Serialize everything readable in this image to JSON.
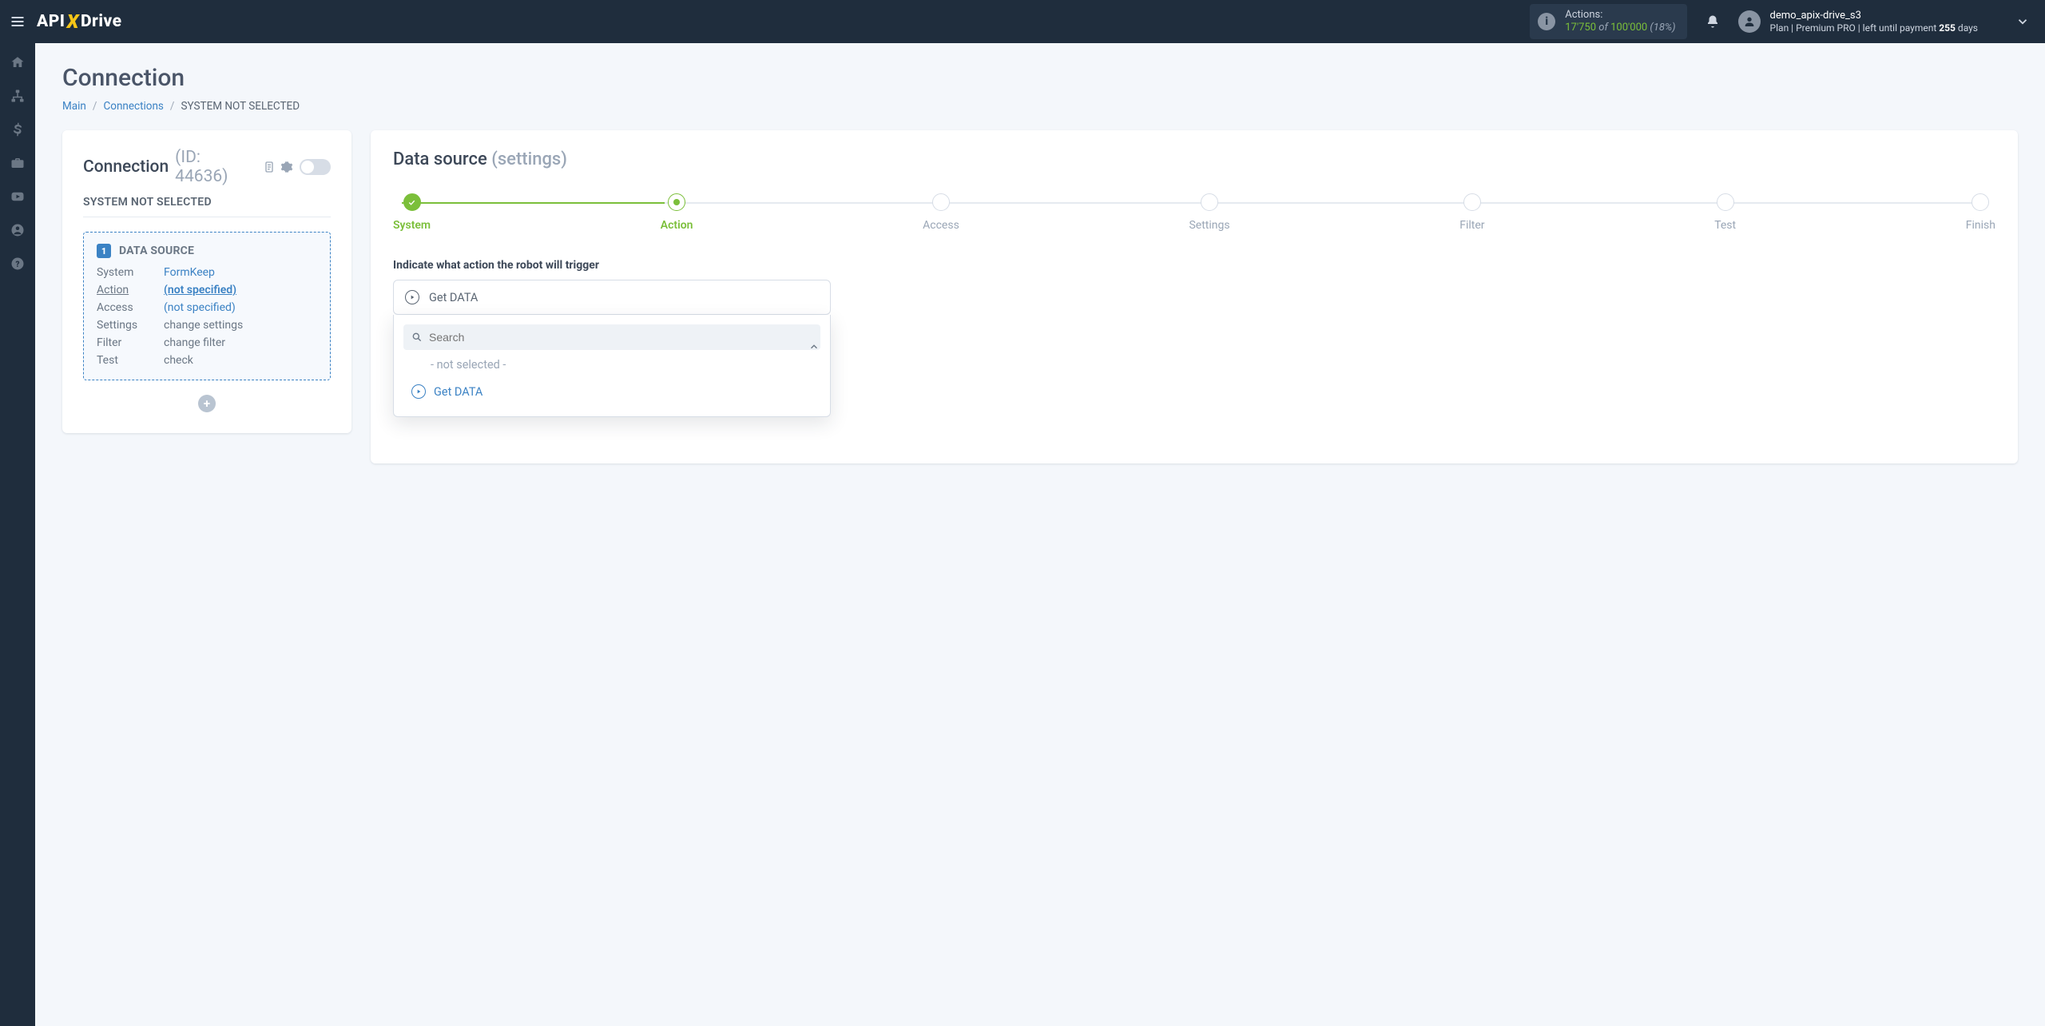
{
  "topbar": {
    "actions_label": "Actions:",
    "actions_used": "17'750",
    "actions_of": "of",
    "actions_total": "100'000",
    "actions_pct": "(18%)",
    "user_name": "demo_apix-drive_s3",
    "user_plan_prefix": "Plan |",
    "user_plan_name": "Premium PRO",
    "user_plan_suffix": "| left until payment",
    "user_days": "255",
    "user_days_word": "days"
  },
  "page": {
    "title": "Connection",
    "breadcrumb": {
      "main": "Main",
      "connections": "Connections",
      "current": "SYSTEM NOT SELECTED"
    }
  },
  "left": {
    "title": "Connection",
    "id_label": "(ID: 44636)",
    "sub": "SYSTEM NOT SELECTED",
    "ds_title": "DATA SOURCE",
    "ds_badge": "1",
    "rows": {
      "system_k": "System",
      "system_v": "FormKeep",
      "action_k": "Action",
      "action_v": "(not specified)",
      "access_k": "Access",
      "access_v": "(not specified)",
      "settings_k": "Settings",
      "settings_v": "change settings",
      "filter_k": "Filter",
      "filter_v": "change filter",
      "test_k": "Test",
      "test_v": "check"
    }
  },
  "right": {
    "title": "Data source",
    "title_muted": "(settings)",
    "steps": {
      "s1": "System",
      "s2": "Action",
      "s3": "Access",
      "s4": "Settings",
      "s5": "Filter",
      "s6": "Test",
      "s7": "Finish"
    },
    "field_label": "Indicate what action the robot will trigger",
    "select_value": "Get DATA",
    "search_placeholder": "Search",
    "opt_none": "- not selected -",
    "opt_get": "Get DATA"
  }
}
